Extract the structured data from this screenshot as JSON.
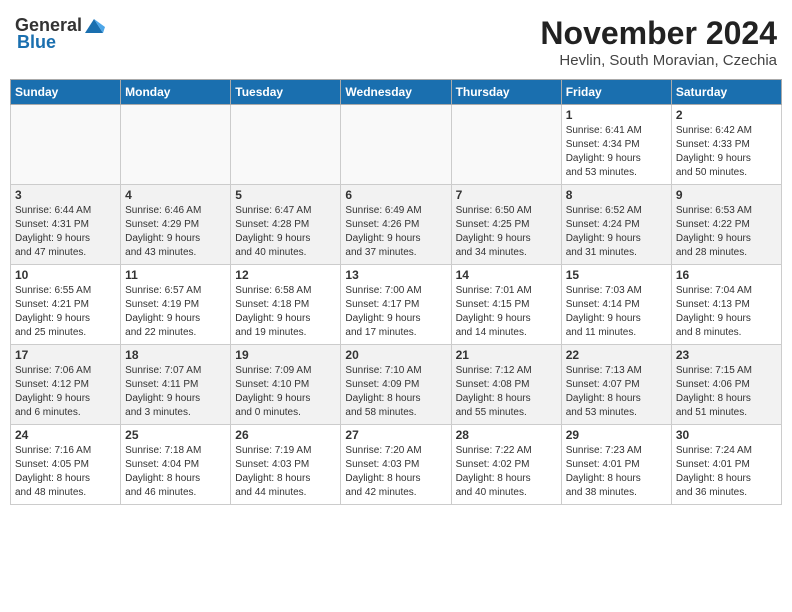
{
  "header": {
    "logo_general": "General",
    "logo_blue": "Blue",
    "month_year": "November 2024",
    "location": "Hevlin, South Moravian, Czechia"
  },
  "weekdays": [
    "Sunday",
    "Monday",
    "Tuesday",
    "Wednesday",
    "Thursday",
    "Friday",
    "Saturday"
  ],
  "weeks": [
    [
      {
        "day": "",
        "info": ""
      },
      {
        "day": "",
        "info": ""
      },
      {
        "day": "",
        "info": ""
      },
      {
        "day": "",
        "info": ""
      },
      {
        "day": "",
        "info": ""
      },
      {
        "day": "1",
        "info": "Sunrise: 6:41 AM\nSunset: 4:34 PM\nDaylight: 9 hours\nand 53 minutes."
      },
      {
        "day": "2",
        "info": "Sunrise: 6:42 AM\nSunset: 4:33 PM\nDaylight: 9 hours\nand 50 minutes."
      }
    ],
    [
      {
        "day": "3",
        "info": "Sunrise: 6:44 AM\nSunset: 4:31 PM\nDaylight: 9 hours\nand 47 minutes."
      },
      {
        "day": "4",
        "info": "Sunrise: 6:46 AM\nSunset: 4:29 PM\nDaylight: 9 hours\nand 43 minutes."
      },
      {
        "day": "5",
        "info": "Sunrise: 6:47 AM\nSunset: 4:28 PM\nDaylight: 9 hours\nand 40 minutes."
      },
      {
        "day": "6",
        "info": "Sunrise: 6:49 AM\nSunset: 4:26 PM\nDaylight: 9 hours\nand 37 minutes."
      },
      {
        "day": "7",
        "info": "Sunrise: 6:50 AM\nSunset: 4:25 PM\nDaylight: 9 hours\nand 34 minutes."
      },
      {
        "day": "8",
        "info": "Sunrise: 6:52 AM\nSunset: 4:24 PM\nDaylight: 9 hours\nand 31 minutes."
      },
      {
        "day": "9",
        "info": "Sunrise: 6:53 AM\nSunset: 4:22 PM\nDaylight: 9 hours\nand 28 minutes."
      }
    ],
    [
      {
        "day": "10",
        "info": "Sunrise: 6:55 AM\nSunset: 4:21 PM\nDaylight: 9 hours\nand 25 minutes."
      },
      {
        "day": "11",
        "info": "Sunrise: 6:57 AM\nSunset: 4:19 PM\nDaylight: 9 hours\nand 22 minutes."
      },
      {
        "day": "12",
        "info": "Sunrise: 6:58 AM\nSunset: 4:18 PM\nDaylight: 9 hours\nand 19 minutes."
      },
      {
        "day": "13",
        "info": "Sunrise: 7:00 AM\nSunset: 4:17 PM\nDaylight: 9 hours\nand 17 minutes."
      },
      {
        "day": "14",
        "info": "Sunrise: 7:01 AM\nSunset: 4:15 PM\nDaylight: 9 hours\nand 14 minutes."
      },
      {
        "day": "15",
        "info": "Sunrise: 7:03 AM\nSunset: 4:14 PM\nDaylight: 9 hours\nand 11 minutes."
      },
      {
        "day": "16",
        "info": "Sunrise: 7:04 AM\nSunset: 4:13 PM\nDaylight: 9 hours\nand 8 minutes."
      }
    ],
    [
      {
        "day": "17",
        "info": "Sunrise: 7:06 AM\nSunset: 4:12 PM\nDaylight: 9 hours\nand 6 minutes."
      },
      {
        "day": "18",
        "info": "Sunrise: 7:07 AM\nSunset: 4:11 PM\nDaylight: 9 hours\nand 3 minutes."
      },
      {
        "day": "19",
        "info": "Sunrise: 7:09 AM\nSunset: 4:10 PM\nDaylight: 9 hours\nand 0 minutes."
      },
      {
        "day": "20",
        "info": "Sunrise: 7:10 AM\nSunset: 4:09 PM\nDaylight: 8 hours\nand 58 minutes."
      },
      {
        "day": "21",
        "info": "Sunrise: 7:12 AM\nSunset: 4:08 PM\nDaylight: 8 hours\nand 55 minutes."
      },
      {
        "day": "22",
        "info": "Sunrise: 7:13 AM\nSunset: 4:07 PM\nDaylight: 8 hours\nand 53 minutes."
      },
      {
        "day": "23",
        "info": "Sunrise: 7:15 AM\nSunset: 4:06 PM\nDaylight: 8 hours\nand 51 minutes."
      }
    ],
    [
      {
        "day": "24",
        "info": "Sunrise: 7:16 AM\nSunset: 4:05 PM\nDaylight: 8 hours\nand 48 minutes."
      },
      {
        "day": "25",
        "info": "Sunrise: 7:18 AM\nSunset: 4:04 PM\nDaylight: 8 hours\nand 46 minutes."
      },
      {
        "day": "26",
        "info": "Sunrise: 7:19 AM\nSunset: 4:03 PM\nDaylight: 8 hours\nand 44 minutes."
      },
      {
        "day": "27",
        "info": "Sunrise: 7:20 AM\nSunset: 4:03 PM\nDaylight: 8 hours\nand 42 minutes."
      },
      {
        "day": "28",
        "info": "Sunrise: 7:22 AM\nSunset: 4:02 PM\nDaylight: 8 hours\nand 40 minutes."
      },
      {
        "day": "29",
        "info": "Sunrise: 7:23 AM\nSunset: 4:01 PM\nDaylight: 8 hours\nand 38 minutes."
      },
      {
        "day": "30",
        "info": "Sunrise: 7:24 AM\nSunset: 4:01 PM\nDaylight: 8 hours\nand 36 minutes."
      }
    ]
  ]
}
